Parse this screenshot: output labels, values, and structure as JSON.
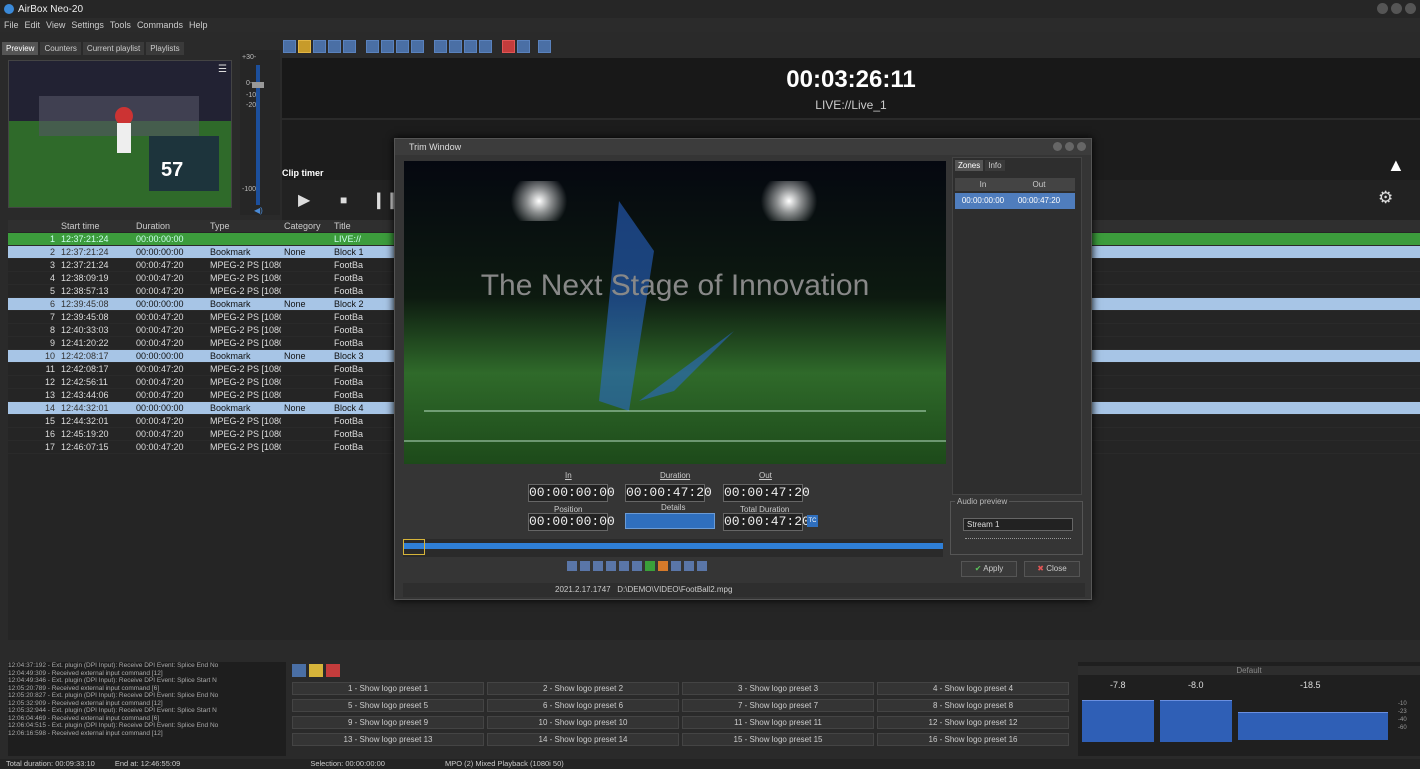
{
  "app": {
    "title": "AirBox Neo-20"
  },
  "menu": [
    "File",
    "Edit",
    "View",
    "Settings",
    "Tools",
    "Commands",
    "Help"
  ],
  "tabs": [
    "Preview",
    "Counters",
    "Current playlist",
    "Playlists"
  ],
  "vu_scale": [
    "+30-",
    "0-",
    "-10-",
    "-20-",
    "-100-"
  ],
  "preview": {
    "score": "57"
  },
  "timer": {
    "time": "00:03:26:11",
    "source": "LIVE://Live_1"
  },
  "clip_timer": {
    "label": "Clip timer"
  },
  "playlist": {
    "columns": [
      "Start time",
      "Duration",
      "Type",
      "Category",
      "Title"
    ],
    "rows": [
      {
        "n": "1",
        "start": "12:37:21:24",
        "dur": "00:00:00:00",
        "type": "",
        "cat": "",
        "title": "LIVE://"
      },
      {
        "n": "2",
        "start": "12:37:21:24",
        "dur": "00:00:00:00",
        "type": "Bookmark",
        "cat": "None",
        "title": "Block 1"
      },
      {
        "n": "3",
        "start": "12:37:21:24",
        "dur": "00:00:47:20",
        "type": "MPEG-2 PS [1080i",
        "cat": "",
        "title": "FootBa"
      },
      {
        "n": "4",
        "start": "12:38:09:19",
        "dur": "00:00:47:20",
        "type": "MPEG-2 PS [1080i",
        "cat": "",
        "title": "FootBa"
      },
      {
        "n": "5",
        "start": "12:38:57:13",
        "dur": "00:00:47:20",
        "type": "MPEG-2 PS [1080i",
        "cat": "",
        "title": "FootBa"
      },
      {
        "n": "6",
        "start": "12:39:45:08",
        "dur": "00:00:00:00",
        "type": "Bookmark",
        "cat": "None",
        "title": "Block 2"
      },
      {
        "n": "7",
        "start": "12:39:45:08",
        "dur": "00:00:47:20",
        "type": "MPEG-2 PS [1080i",
        "cat": "",
        "title": "FootBa"
      },
      {
        "n": "8",
        "start": "12:40:33:03",
        "dur": "00:00:47:20",
        "type": "MPEG-2 PS [1080i",
        "cat": "",
        "title": "FootBa"
      },
      {
        "n": "9",
        "start": "12:41:20:22",
        "dur": "00:00:47:20",
        "type": "MPEG-2 PS [1080i",
        "cat": "",
        "title": "FootBa"
      },
      {
        "n": "10",
        "start": "12:42:08:17",
        "dur": "00:00:00:00",
        "type": "Bookmark",
        "cat": "None",
        "title": "Block 3"
      },
      {
        "n": "11",
        "start": "12:42:08:17",
        "dur": "00:00:47:20",
        "type": "MPEG-2 PS [1080i",
        "cat": "",
        "title": "FootBa"
      },
      {
        "n": "12",
        "start": "12:42:56:11",
        "dur": "00:00:47:20",
        "type": "MPEG-2 PS [1080i",
        "cat": "",
        "title": "FootBa"
      },
      {
        "n": "13",
        "start": "12:43:44:06",
        "dur": "00:00:47:20",
        "type": "MPEG-2 PS [1080i",
        "cat": "",
        "title": "FootBa"
      },
      {
        "n": "14",
        "start": "12:44:32:01",
        "dur": "00:00:00:00",
        "type": "Bookmark",
        "cat": "None",
        "title": "Block 4"
      },
      {
        "n": "15",
        "start": "12:44:32:01",
        "dur": "00:00:47:20",
        "type": "MPEG-2 PS [1080i",
        "cat": "",
        "title": "FootBa"
      },
      {
        "n": "16",
        "start": "12:45:19:20",
        "dur": "00:00:47:20",
        "type": "MPEG-2 PS [1080i",
        "cat": "",
        "title": "FootBa"
      },
      {
        "n": "17",
        "start": "12:46:07:15",
        "dur": "00:00:47:20",
        "type": "MPEG-2 PS [1080i",
        "cat": "",
        "title": "FootBa"
      }
    ]
  },
  "trim": {
    "title": "Trim Window",
    "tagline": "The Next Stage of Innovation",
    "zones_tabs": [
      "Zones",
      "Info"
    ],
    "zones_cols": [
      "In",
      "Out"
    ],
    "zone_in": "00:00:00:00",
    "zone_out": "00:00:47:20",
    "in_label": "In",
    "in_value": "00:00:00:00",
    "duration_label": "Duration",
    "duration_value": "00:00:47:20",
    "out_label": "Out",
    "out_value": "00:00:47:20",
    "position_label": "Position",
    "position_value": "00:00:00:00",
    "details_label": "Details",
    "total_label": "Total Duration",
    "total_value": "00:00:47:20",
    "tc_badge": "TC",
    "audio_preview_label": "Audio preview",
    "audio_stream": "Stream 1",
    "apply": "Apply",
    "close": "Close",
    "status_version": "2021.2.17.1747",
    "status_path": "D:\\DEMO\\VIDEO\\FootBall2.mpg"
  },
  "log": [
    "12:04:37:192 - Ext. plugin (DPI Input): Receive DPI Event: Splice End No",
    "12:04:49:309 - Received external input command [12]",
    "12:04:49:346 - Ext. plugin (DPI Input): Receive DPI Event: Splice Start N",
    "12:05:20:789 - Received external input command [6]",
    "12:05:20:827 - Ext. plugin (DPI Input): Receive DPI Event: Splice End No",
    "12:05:32:909 - Received external input command [12]",
    "12:05:32:944 - Ext. plugin (DPI Input): Receive DPI Event: Splice Start N",
    "12:06:04:469 - Received external input command [6]",
    "12:06:04:515 - Ext. plugin (DPI Input): Receive DPI Event: Splice End No",
    "12:06:16:598 - Received external input command [12]"
  ],
  "presets": [
    "1 - Show logo preset 1",
    "2 - Show logo preset 2",
    "3 - Show logo preset 3",
    "4 - Show logo preset 4",
    "5 - Show logo preset 5",
    "6 - Show logo preset 6",
    "7 - Show logo preset 7",
    "8 - Show logo preset 8",
    "9 - Show logo preset 9",
    "10 - Show logo preset 10",
    "11 - Show logo preset 11",
    "12 - Show logo preset 12",
    "13 - Show logo preset 13",
    "14 - Show logo preset 14",
    "15 - Show logo preset 15",
    "16 - Show logo preset 16"
  ],
  "audio_panel": {
    "preset": "Default",
    "levels": [
      "-7.8",
      "-8.0",
      "-18.5"
    ],
    "scale": [
      "-10",
      "-23",
      "-40",
      "-60"
    ]
  },
  "status": {
    "total_duration": "Total duration: 00:09:33:10",
    "end_at": "End at: 12:46:55:09",
    "selection": "Selection: 00:00:00:00",
    "mode": "MPO (2) Mixed Playback (1080i 50)"
  }
}
